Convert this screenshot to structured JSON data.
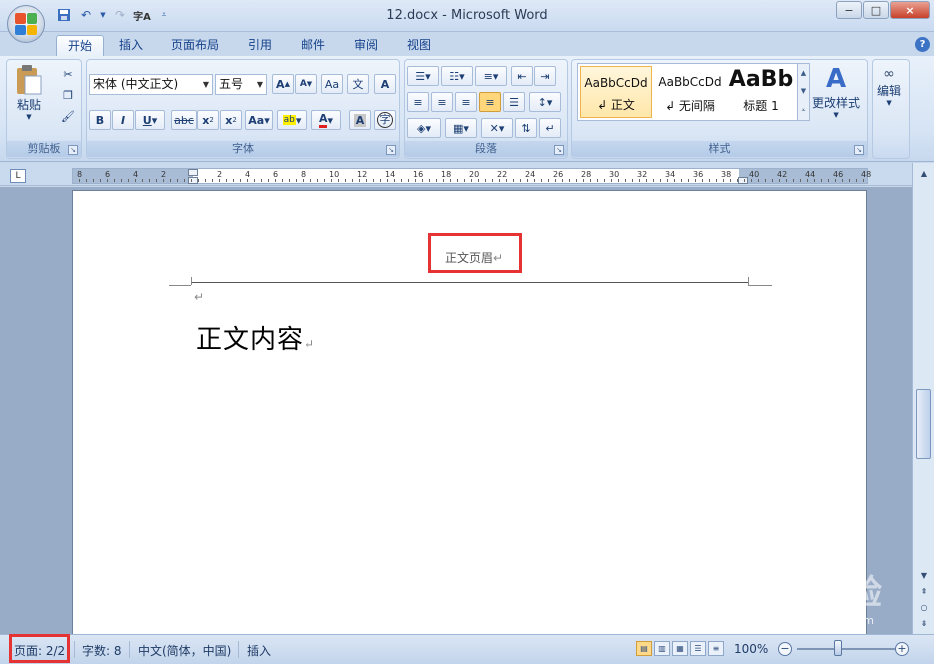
{
  "window": {
    "title": "12.docx - Microsoft Word",
    "minimize": "−",
    "maximize": "□",
    "close": "×"
  },
  "tabs": [
    "开始",
    "插入",
    "页面布局",
    "引用",
    "邮件",
    "审阅",
    "视图"
  ],
  "ribbon": {
    "clipboard": {
      "label": "剪贴板",
      "paste": "粘贴"
    },
    "font": {
      "label": "字体",
      "font_name": "宋体 (中文正文)",
      "font_size": "五号"
    },
    "paragraph": {
      "label": "段落"
    },
    "styles": {
      "label": "样式",
      "items": [
        {
          "sample": "AaBbCcDd",
          "name": "↲ 正文"
        },
        {
          "sample": "AaBbCcDd",
          "name": "↲ 无间隔"
        },
        {
          "sample": "AaBb",
          "name": "标题 1"
        }
      ],
      "change_styles": "更改样式"
    },
    "editing": {
      "label": "编辑"
    }
  },
  "ruler": {
    "numbers": [
      "8",
      "6",
      "4",
      "2",
      "2",
      "4",
      "6",
      "8",
      "10",
      "12",
      "14",
      "16",
      "18",
      "20",
      "22",
      "24",
      "26",
      "28",
      "30",
      "32",
      "34",
      "36",
      "38",
      "40",
      "42",
      "44",
      "46",
      "48"
    ]
  },
  "document": {
    "header_text": "正文页眉",
    "header_mark": "↵",
    "empty_para_mark": "↵",
    "body_text": "正文内容",
    "body_mark": "↵"
  },
  "statusbar": {
    "page": "页面: 2/2",
    "word_count": "字数: 8",
    "language": "中文(简体，中国)",
    "mode": "插入",
    "zoom": "100%"
  },
  "watermark": {
    "text": "Bai du 经验",
    "url": "jingyan.baidu.com"
  },
  "colors": {
    "highlight_box": "#e53333",
    "accent": "#15428b"
  }
}
